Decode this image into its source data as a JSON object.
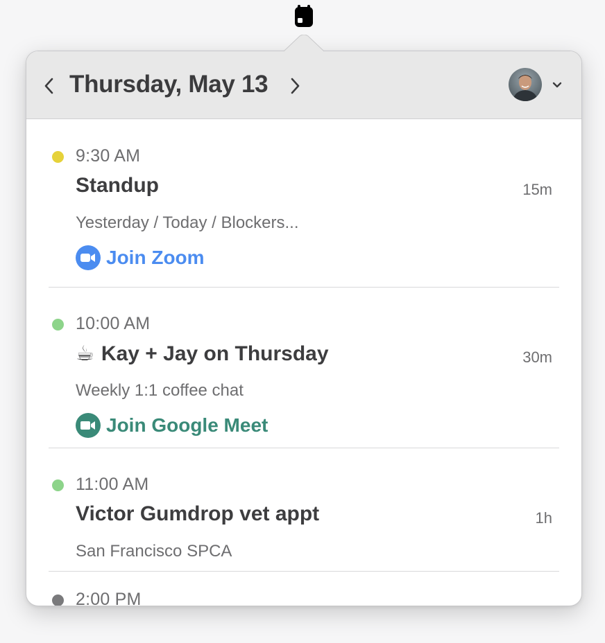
{
  "menubar": {
    "icon": "calendar-icon"
  },
  "header": {
    "date_title": "Thursday, May 13",
    "prev_icon": "chevron-left-icon",
    "next_icon": "chevron-right-icon",
    "account_icon": "chevron-down-icon"
  },
  "events": [
    {
      "time": "9:30 AM",
      "title": "Standup",
      "duration": "15m",
      "description": "Yesterday / Today / Blockers...",
      "dot_color": "#e6d23a",
      "join": {
        "label": "Join Zoom",
        "color": "#4b8cf0",
        "icon": "zoom-video-icon"
      }
    },
    {
      "time": "10:00 AM",
      "emoji": "☕",
      "title": "Kay + Jay on Thursday",
      "duration": "30m",
      "description": "Weekly 1:1 coffee chat",
      "dot_color": "#8dd48a",
      "join": {
        "label": "Join Google Meet",
        "color": "#3a8a78",
        "icon": "google-meet-video-icon"
      }
    },
    {
      "time": "11:00 AM",
      "title": "Victor Gumdrop vet appt",
      "duration": "1h",
      "description": "San Francisco SPCA",
      "dot_color": "#8dd48a"
    },
    {
      "time": "2:00 PM",
      "dot_color": "#7a7a7c"
    }
  ]
}
